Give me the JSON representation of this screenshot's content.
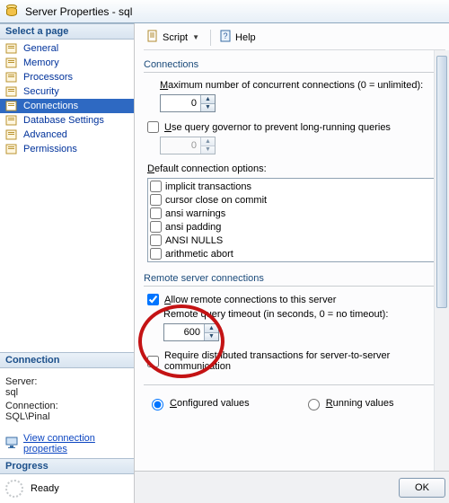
{
  "window": {
    "title": "Server Properties - sql"
  },
  "toolbar": {
    "script": "Script",
    "help": "Help"
  },
  "sidebar": {
    "select_label": "Select a page",
    "items": [
      {
        "label": "General"
      },
      {
        "label": "Memory"
      },
      {
        "label": "Processors"
      },
      {
        "label": "Security"
      },
      {
        "label": "Connections",
        "selected": true
      },
      {
        "label": "Database Settings"
      },
      {
        "label": "Advanced"
      },
      {
        "label": "Permissions"
      }
    ],
    "connection_label": "Connection",
    "server_label": "Server:",
    "server_value": "sql",
    "conn_label2": "Connection:",
    "conn_value": "SQL\\Pinal",
    "view_conn_link": "View connection properties",
    "progress_label": "Progress",
    "ready": "Ready"
  },
  "main": {
    "connections_header": "Connections",
    "max_conn_label_pre": "M",
    "max_conn_label_rest": "aximum number of concurrent connections (0 = unlimited):",
    "max_conn_value": "0",
    "use_qgovernor_pre": "U",
    "use_qgovernor_rest": "se query governor to prevent long-running queries",
    "qgov_value": "0",
    "default_opts_pre": "D",
    "default_opts_rest": "efault connection options:",
    "opts": [
      "implicit transactions",
      "cursor close on commit",
      "ansi warnings",
      "ansi padding",
      "ANSI NULLS",
      "arithmetic abort"
    ],
    "remote_header": "Remote server connections",
    "allow_remote_pre": "A",
    "allow_remote_rest": "llow remote connections to this server",
    "remote_timeout_label": "Remote query timeout (in seconds, 0 = no timeout):",
    "remote_timeout_value": "600",
    "require_dist_label": "Require distributed transactions for server-to-server communication",
    "configured_pre": "C",
    "configured_rest": "onfigured values",
    "running_pre": "R",
    "running_rest": "unning values"
  },
  "footer": {
    "ok": "OK"
  }
}
